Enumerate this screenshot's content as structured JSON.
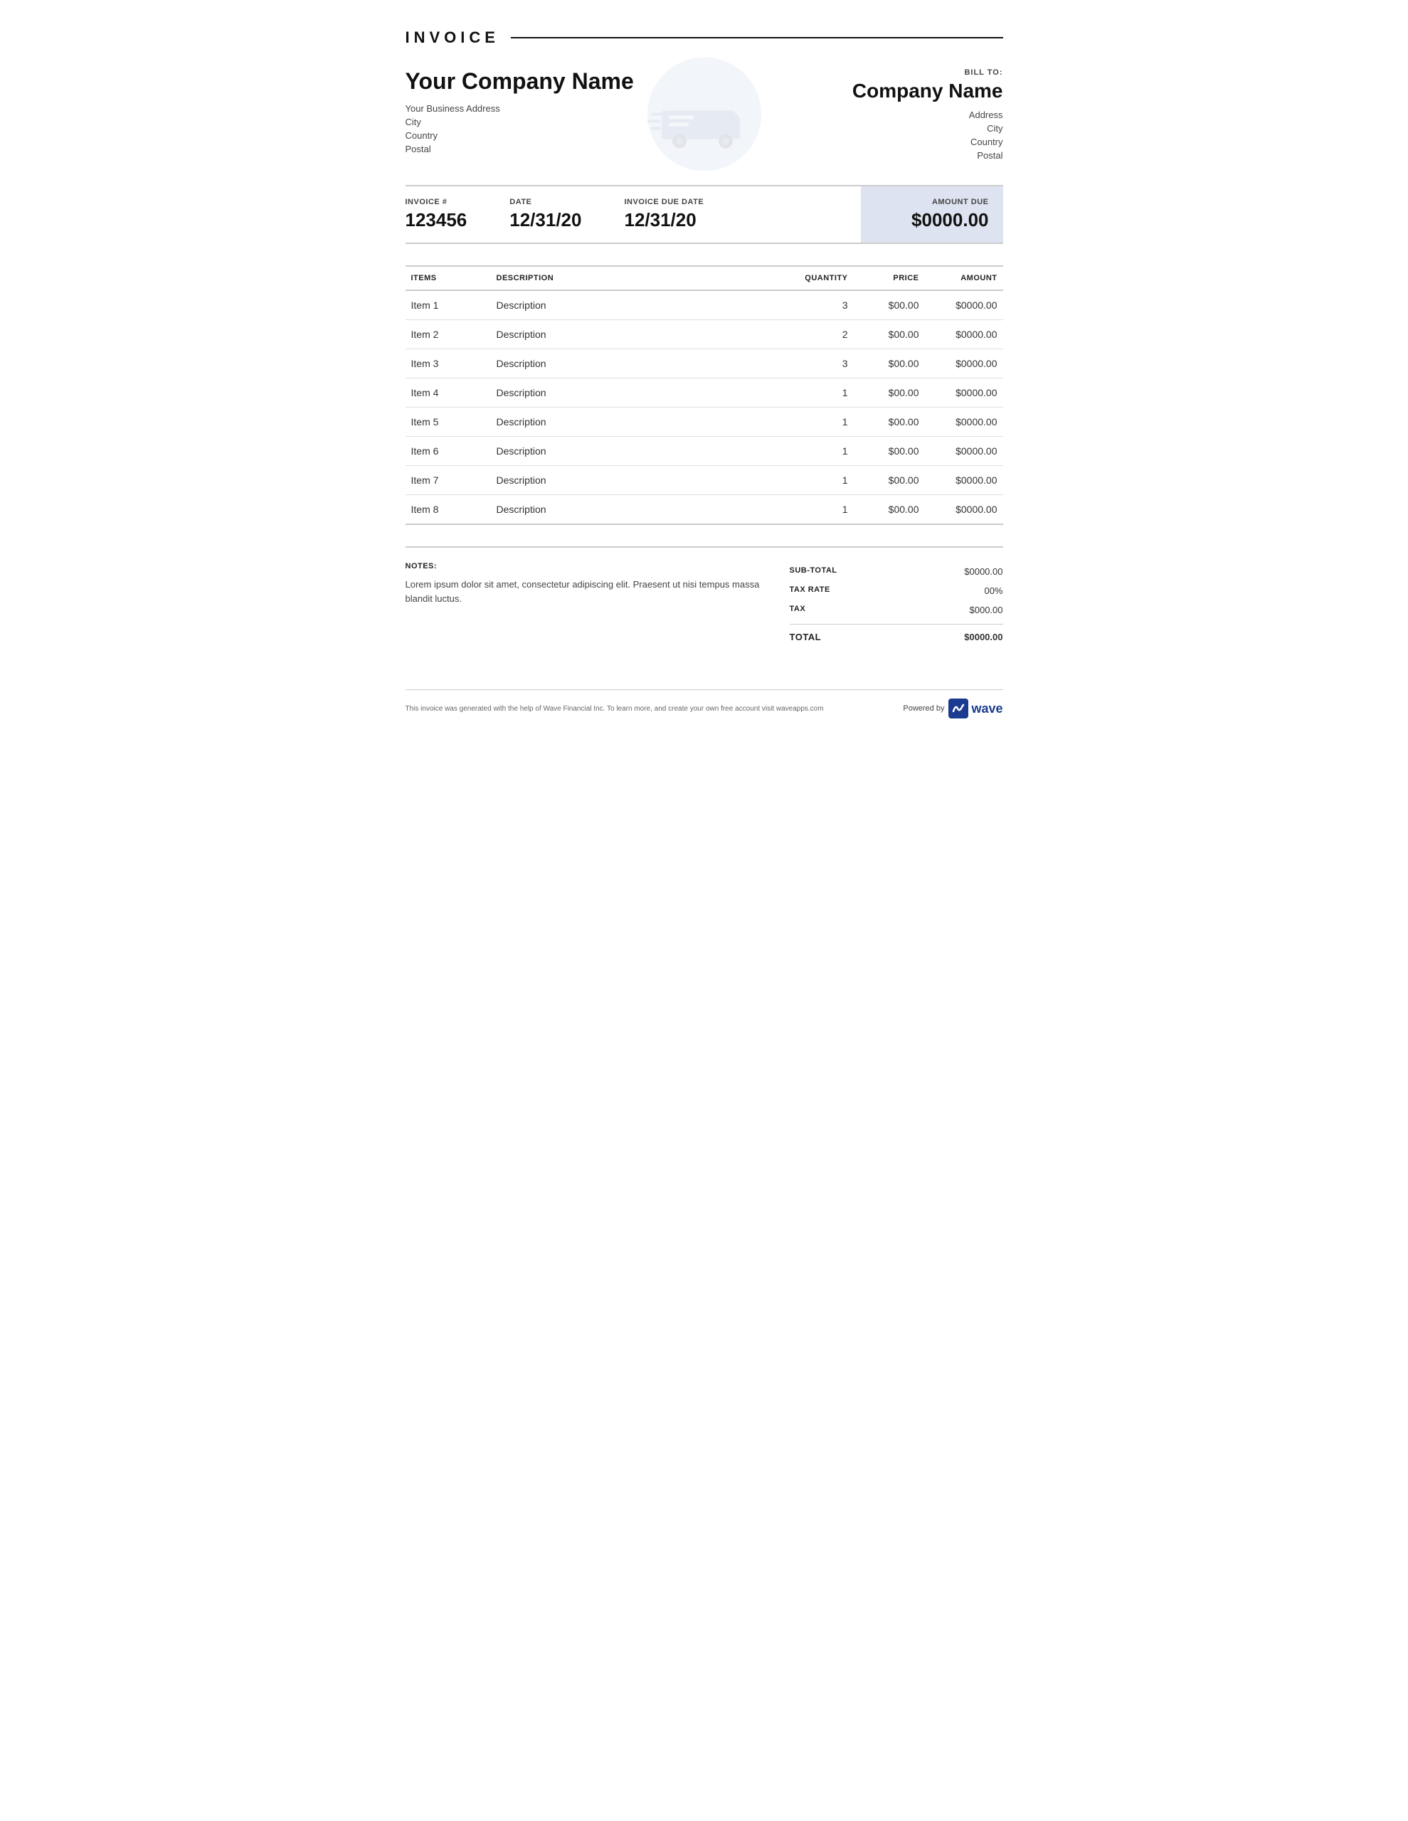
{
  "header": {
    "title": "INVOICE"
  },
  "company": {
    "name": "Your Company Name",
    "address": "Your Business Address",
    "city": "City",
    "country": "Country",
    "postal": "Postal"
  },
  "bill_to": {
    "label": "BILL TO:",
    "name": "Company Name",
    "address": "Address",
    "city": "City",
    "country": "Country",
    "postal": "Postal"
  },
  "invoice_meta": {
    "invoice_number_label": "INVOICE #",
    "invoice_number": "123456",
    "date_label": "DATE",
    "date": "12/31/20",
    "due_date_label": "INVOICE DUE DATE",
    "due_date": "12/31/20",
    "amount_due_label": "AMOUNT DUE",
    "amount_due": "$0000.00"
  },
  "table": {
    "col_items": "ITEMS",
    "col_description": "DESCRIPTION",
    "col_quantity": "QUANTITY",
    "col_price": "PRICE",
    "col_amount": "AMOUNT",
    "rows": [
      {
        "item": "Item 1",
        "description": "Description",
        "quantity": "3",
        "price": "$00.00",
        "amount": "$0000.00"
      },
      {
        "item": "Item 2",
        "description": "Description",
        "quantity": "2",
        "price": "$00.00",
        "amount": "$0000.00"
      },
      {
        "item": "Item 3",
        "description": "Description",
        "quantity": "3",
        "price": "$00.00",
        "amount": "$0000.00"
      },
      {
        "item": "Item 4",
        "description": "Description",
        "quantity": "1",
        "price": "$00.00",
        "amount": "$0000.00"
      },
      {
        "item": "Item 5",
        "description": "Description",
        "quantity": "1",
        "price": "$00.00",
        "amount": "$0000.00"
      },
      {
        "item": "Item 6",
        "description": "Description",
        "quantity": "1",
        "price": "$00.00",
        "amount": "$0000.00"
      },
      {
        "item": "Item 7",
        "description": "Description",
        "quantity": "1",
        "price": "$00.00",
        "amount": "$0000.00"
      },
      {
        "item": "Item 8",
        "description": "Description",
        "quantity": "1",
        "price": "$00.00",
        "amount": "$0000.00"
      }
    ]
  },
  "notes": {
    "label": "NOTES:",
    "text": "Lorem ipsum dolor sit amet, consectetur adipiscing elit. Praesent ut nisi tempus massa blandit luctus."
  },
  "totals": {
    "subtotal_label": "SUB-TOTAL",
    "subtotal_value": "$0000.00",
    "tax_rate_label": "TAX RATE",
    "tax_rate_value": "00%",
    "tax_label": "TAX",
    "tax_value": "$000.00",
    "total_label": "TOTAL",
    "total_value": "$0000.00"
  },
  "footer": {
    "note": "This invoice was generated with the help of Wave Financial Inc. To learn more, and create your own free account visit waveapps.com",
    "powered_by": "Powered by",
    "wave": "wave"
  }
}
